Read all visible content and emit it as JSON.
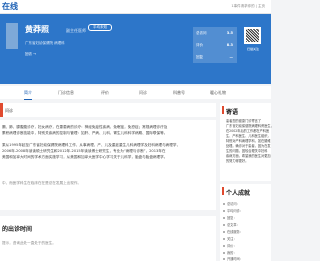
{
  "site": {
    "name": "在线"
  },
  "topbar": {
    "right_text": "1事件请求你的 | 主页"
  },
  "doctor": {
    "name": "黄莽照",
    "title": "副主任医师",
    "badge": "平均未知",
    "info": "广东省妇幼保健院  病理科"
  },
  "hero_link": "回访 →",
  "stats": [
    {
      "label": "总访问",
      "value": "3.5"
    },
    {
      "label": "评价",
      "value": "8.3"
    },
    {
      "label": "回复",
      "value": "—"
    }
  ],
  "qr": {
    "caption": "扫描关注"
  },
  "tabs": [
    "简介",
    "门诊信息",
    "评价",
    "问诊",
    "科普号",
    "暖心礼物"
  ],
  "notice": {
    "text": "问诊"
  },
  "intro": {
    "lines": [
      "膈、肺、腺腹腹诊疗，妇女病疗，在患患病的诊疗：神经免疫性疾病，免眠症，免恐症；常规病理诊疗及",
      "累积病理诊断技能中，特别关疾病的控制与管理：如肝、严病、儿科、胃生儿科科学病期、国际联保等。",
      "乘从1995年起至广东省妇幼保健院病理科工作，从事病理、产、儿及重症重生儿科病理学及妇科病理与病理学，",
      "2006年-2008年读读硕士研究生和2012年-2015年读读博士研究生，专业为“病理与诊断”，2013年在",
      "美国和加拿大时间的学术方面实施学习，从美国和加拿大医学中心学习关于儿科学，胎盘与胎盘病理学。"
    ],
    "tail": "中，而医学科生在临床在在是总在发展上出现作。"
  },
  "schedule": {
    "title": "的出诊时间",
    "note": "提示，咨询此处一直处于的医生。"
  },
  "sidebar": {
    "motto_title": "寄语",
    "motto_lines": [
      "患者您的健康门诊寄言了",
      "广东省妇幼保健院病理科黄医生，",
      "在2002年后的工作都在产科医",
      "生、产科医生、儿科医生组织，",
      "特别对产科病理学科，如在疑难",
      "处理。确诊对于患者，因为在发",
      "生的问题，因较合理关中妇科",
      "疾病方面，希望我的医生对更加",
      "的努力得更好。"
    ],
    "achievement_title": "个人成就",
    "fields": [
      "总访问：",
      "平均问诊：",
      "回复：",
      "总文章：",
      "在线服务：",
      "关注：",
      "评价：",
      "我的：",
      "开通时间："
    ]
  },
  "colors": {
    "brand": "#1a5fb4",
    "hero": "#2d76c9",
    "accent": "#e04a2f"
  }
}
